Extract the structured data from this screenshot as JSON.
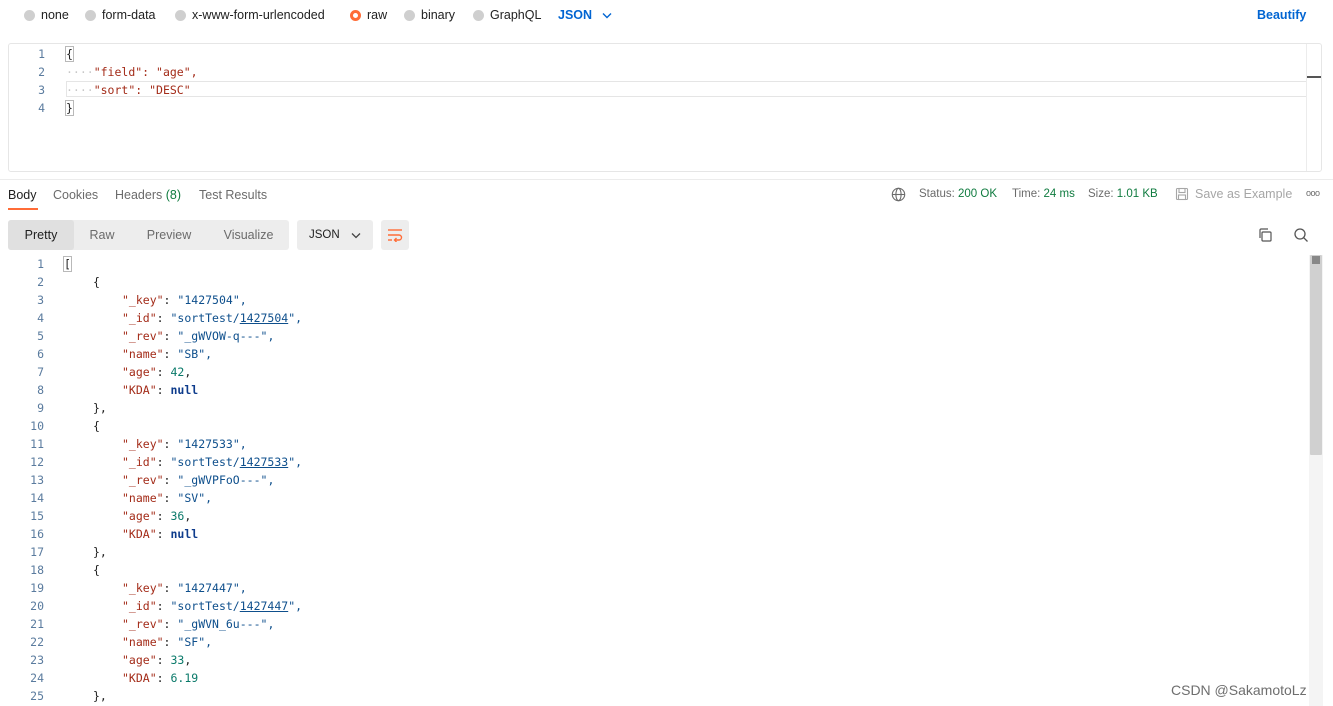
{
  "body_types": {
    "options": [
      {
        "label": "none",
        "selected": false
      },
      {
        "label": "form-data",
        "selected": false
      },
      {
        "label": "x-www-form-urlencoded",
        "selected": false
      },
      {
        "label": "raw",
        "selected": true
      },
      {
        "label": "binary",
        "selected": false
      },
      {
        "label": "GraphQL",
        "selected": false
      }
    ],
    "language": "JSON",
    "beautify_label": "Beautify"
  },
  "request_body": {
    "line_numbers": [
      "1",
      "2",
      "3",
      "4"
    ],
    "lines": [
      "{",
      "\"field\": \"age\",",
      "\"sort\": \"DESC\"",
      "}"
    ]
  },
  "response_tabs": {
    "body": "Body",
    "cookies": "Cookies",
    "headers": "Headers",
    "headers_count": "(8)",
    "test_results": "Test Results"
  },
  "response_meta": {
    "status_label": "Status:",
    "status_value": "200 OK",
    "time_label": "Time:",
    "time_value": "24 ms",
    "size_label": "Size:",
    "size_value": "1.01 KB",
    "save_label": "Save as Example",
    "more": "ooo"
  },
  "view_modes": {
    "pretty": "Pretty",
    "raw": "Raw",
    "preview": "Preview",
    "visualize": "Visualize",
    "format": "JSON"
  },
  "response_body": {
    "line_numbers": [
      "1",
      "2",
      "3",
      "4",
      "5",
      "6",
      "7",
      "8",
      "9",
      "10",
      "11",
      "12",
      "13",
      "14",
      "15",
      "16",
      "17",
      "18",
      "19",
      "20",
      "21",
      "22",
      "23",
      "24",
      "25"
    ],
    "records": [
      {
        "key": "1427504",
        "id_prefix": "sortTest/",
        "id_num": "1427504",
        "rev": "_gWVOW-q---",
        "name": "SB",
        "age": "42",
        "kda": "null"
      },
      {
        "key": "1427533",
        "id_prefix": "sortTest/",
        "id_num": "1427533",
        "rev": "_gWVPFoO---",
        "name": "SV",
        "age": "36",
        "kda": "null"
      },
      {
        "key": "1427447",
        "id_prefix": "sortTest/",
        "id_num": "1427447",
        "rev": "_gWVN_6u---",
        "name": "SF",
        "age": "33",
        "kda": "6.19"
      }
    ]
  },
  "watermark": "CSDN @SakamotoLz",
  "colors": {
    "accent": "#ff6c37",
    "link": "#0265d2",
    "success": "#0f7b3f"
  }
}
